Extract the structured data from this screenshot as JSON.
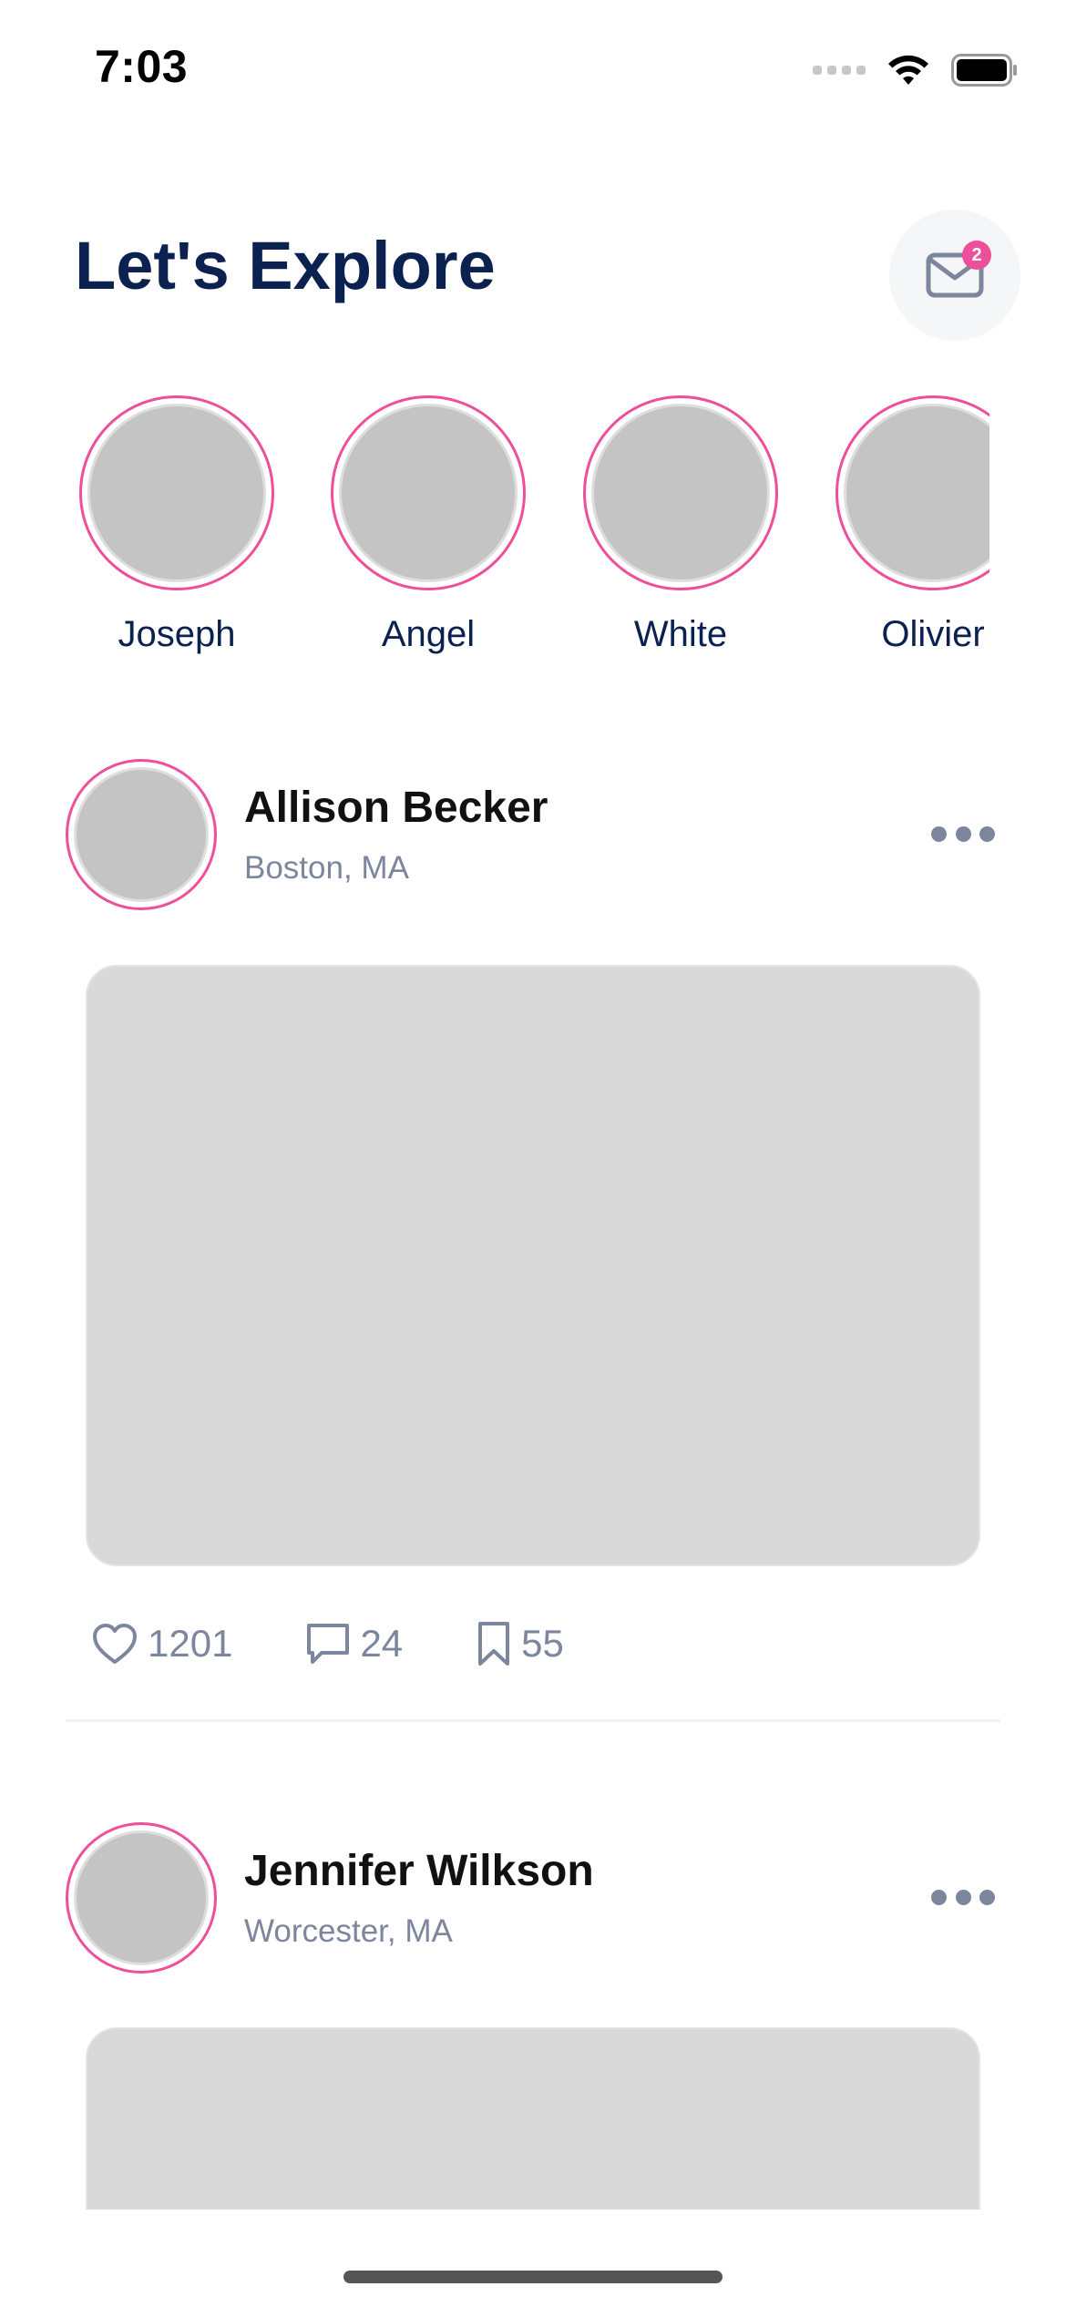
{
  "status_bar": {
    "time": "7:03"
  },
  "header": {
    "title": "Let's Explore",
    "notification_count": "2"
  },
  "stories": [
    {
      "name": "Joseph"
    },
    {
      "name": "Angel"
    },
    {
      "name": "White"
    },
    {
      "name": "Olivier"
    }
  ],
  "posts": [
    {
      "author": "Allison Becker",
      "location": "Boston, MA",
      "likes": "1201",
      "comments": "24",
      "saves": "55"
    },
    {
      "author": "Jennifer Wilkson",
      "location": "Worcester, MA"
    }
  ],
  "colors": {
    "accent": "#ee4f9a",
    "title": "#0b2150",
    "muted": "#7c869c",
    "placeholder": "#c4c4c4",
    "image_placeholder": "#d9d9d9"
  }
}
